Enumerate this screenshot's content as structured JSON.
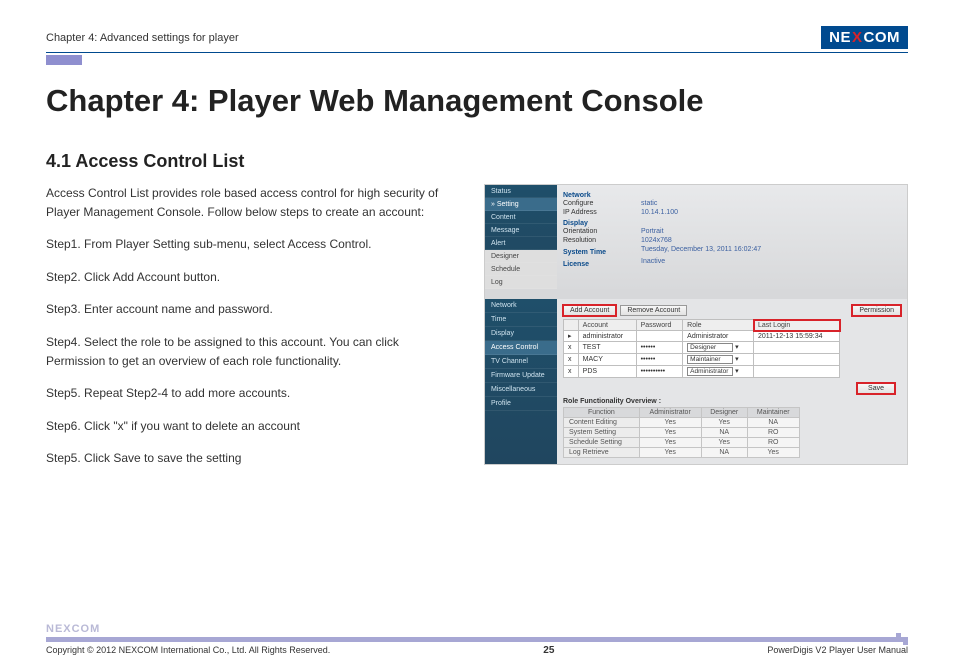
{
  "header": {
    "chapter_label": "Chapter 4: Advanced settings for player",
    "logo": {
      "pre": "NE",
      "x": "X",
      "post": "COM"
    }
  },
  "title": "Chapter 4: Player Web Management Console",
  "section": "4.1 Access Control List",
  "body": {
    "intro": "Access Control List provides role based access control for high security of Player Management Console. Follow below steps to create an account:",
    "steps": [
      "Step1. From Player Setting sub-menu, select Access Control.",
      "Step2. Click Add Account button.",
      "Step3. Enter account name and password.",
      "Step4. Select the role to be assigned to this account. You can click Permission to get an overview of each role functionality.",
      "Step5. Repeat Step2-4 to add more accounts.",
      "Step6. Click \"x\" if you want to delete an account",
      "Step5. Click Save to save the setting"
    ]
  },
  "screenshot": {
    "menu1": [
      "Status",
      "» Setting",
      "Content",
      "Message",
      "Alert",
      "Designer",
      "Schedule",
      "Log"
    ],
    "info": {
      "network_hdr": "Network",
      "rows1": [
        {
          "k": "Configure",
          "v": "static"
        },
        {
          "k": "IP Address",
          "v": "10.14.1.100"
        }
      ],
      "display_hdr": "Display",
      "rows2": [
        {
          "k": "Orientation",
          "v": "Portrait"
        },
        {
          "k": "Resolution",
          "v": "1024x768"
        }
      ],
      "systime_hdr": "System Time",
      "systime_val": "Tuesday, December 13, 2011 16:02:47",
      "license_hdr": "License",
      "license_val": "Inactive"
    },
    "menu2": [
      "Network",
      "Time",
      "Display",
      "Access Control",
      "TV Channel",
      "Firmware Update",
      "Miscellaneous",
      "Profile"
    ],
    "buttons": {
      "add": "Add Account",
      "remove": "Remove Account",
      "permission": "Permission"
    },
    "acct_table": {
      "headers": [
        "",
        "Account",
        "Password",
        "Role",
        "Last Login"
      ],
      "rows": [
        {
          "acc": "administrator",
          "pwd": "",
          "role": "Administrator",
          "login": "2011-12-13 15:59:34"
        },
        {
          "acc": "TEST",
          "pwd": "••••••",
          "role": "Designer",
          "login": ""
        },
        {
          "acc": "MACY",
          "pwd": "••••••",
          "role": "Maintainer",
          "login": ""
        },
        {
          "acc": "PDS",
          "pwd": "••••••••••",
          "role": "Administrator",
          "login": ""
        }
      ]
    },
    "save": "Save",
    "overview_title": "Role Functionality Overview :",
    "overview": {
      "headers": [
        "Function",
        "Administrator",
        "Designer",
        "Maintainer"
      ],
      "rows": [
        [
          "Content Editing",
          "Yes",
          "Yes",
          "NA"
        ],
        [
          "System Setting",
          "Yes",
          "NA",
          "RO"
        ],
        [
          "Schedule Setting",
          "Yes",
          "Yes",
          "RO"
        ],
        [
          "Log Retrieve",
          "Yes",
          "NA",
          "Yes"
        ]
      ]
    }
  },
  "footer": {
    "logo": "NEXCOM",
    "copyright": "Copyright © 2012 NEXCOM International Co., Ltd. All Rights Reserved.",
    "page": "25",
    "doc": "PowerDigis V2 Player User Manual"
  }
}
